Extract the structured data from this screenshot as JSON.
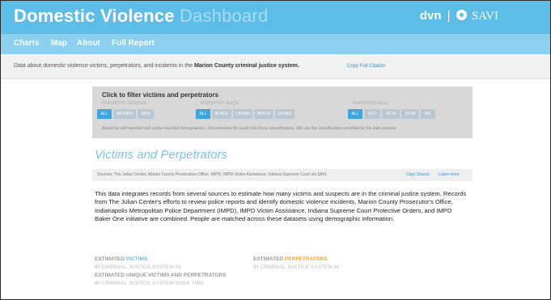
{
  "header": {
    "title_main": "Domestic Violence",
    "title_accent": "Dashboard",
    "brand_dvn": "dvn",
    "brand_sep": "|",
    "brand_savi": "SAVI"
  },
  "nav": {
    "items": [
      "Charts",
      "Map",
      "About",
      "Full Report"
    ]
  },
  "intro": {
    "text_before": "Data about domestic violence victims, perpetrators, and incidents in the",
    "text_bold": "Marion County criminal justice system.",
    "copy_citation": "Copy Full Citation"
  },
  "filters": {
    "title": "Click to filter victims and perpetrators",
    "gender": {
      "label": "REPORTED GENDER",
      "options": [
        "ALL",
        "WOMEN",
        "MEN"
      ],
      "selected": "ALL"
    },
    "race": {
      "label": "REPORTED RACE",
      "options": [
        "ALL",
        "BLACK",
        "LATINO",
        "WHITE",
        "OTHER"
      ],
      "selected": "ALL"
    },
    "age": {
      "label": "REPORTED AGE",
      "options": [
        "ALL",
        "0-17",
        "18-24",
        "25-39",
        "40+"
      ],
      "selected": "ALL"
    },
    "note": "Based on self-reported and police-reported demographics. Not everyone fits easily into these classifications. We use the classifications provided by the data sources."
  },
  "section": {
    "heading": "Victims and Perpetrators",
    "sources": "Sources: The Julian Center, Marion County Prosecutors Office, IMPD, IMPD Victim Assistance, Indiana Supreme Court via SAVI.",
    "copy_source": "Copy Source",
    "learn_more": "Learn more",
    "body": "This data integrates records from several sources to estimate how many victims and suspects are in the criminal justice system. Records from The Julian Center's efforts to review police reports and identify domestic violence incidents, Marion County Prosecutor's Office, Indianapolis Metropolitan Police Department (IMPD), IMPD Victim Assistance, Indiana Supreme Court Protective Orders, and IMPD Baker One initiative are combined. People are matched across these datasets using demographic information."
  },
  "estimates": {
    "victims_prefix": "ESTIMATED",
    "victims_word": "VICTIMS",
    "victims_sub": "IN CRIMINAL JUSTICE SYSTEM IN",
    "perps_prefix": "ESTIMATED",
    "perps_word": "PERPETRATORS",
    "perps_sub": "IN CRIMINAL JUSTICE SYSTEM IN",
    "unique_title": "ESTIMATED UNIQUE VICTIMS AND PERPETRATORS",
    "unique_sub": "IN CRIMINAL JUSTICE SYSTEM OVER TIME"
  },
  "colors": {
    "header": "#5bbde8",
    "nav": "#8ccfee",
    "button_selected": "#3fa6dd",
    "button": "#b8c7d2",
    "victims": "#5bbde8",
    "perpetrators": "#f5a623",
    "estimate_label": "#999999"
  },
  "icons": {
    "brand": "gear-icon"
  }
}
